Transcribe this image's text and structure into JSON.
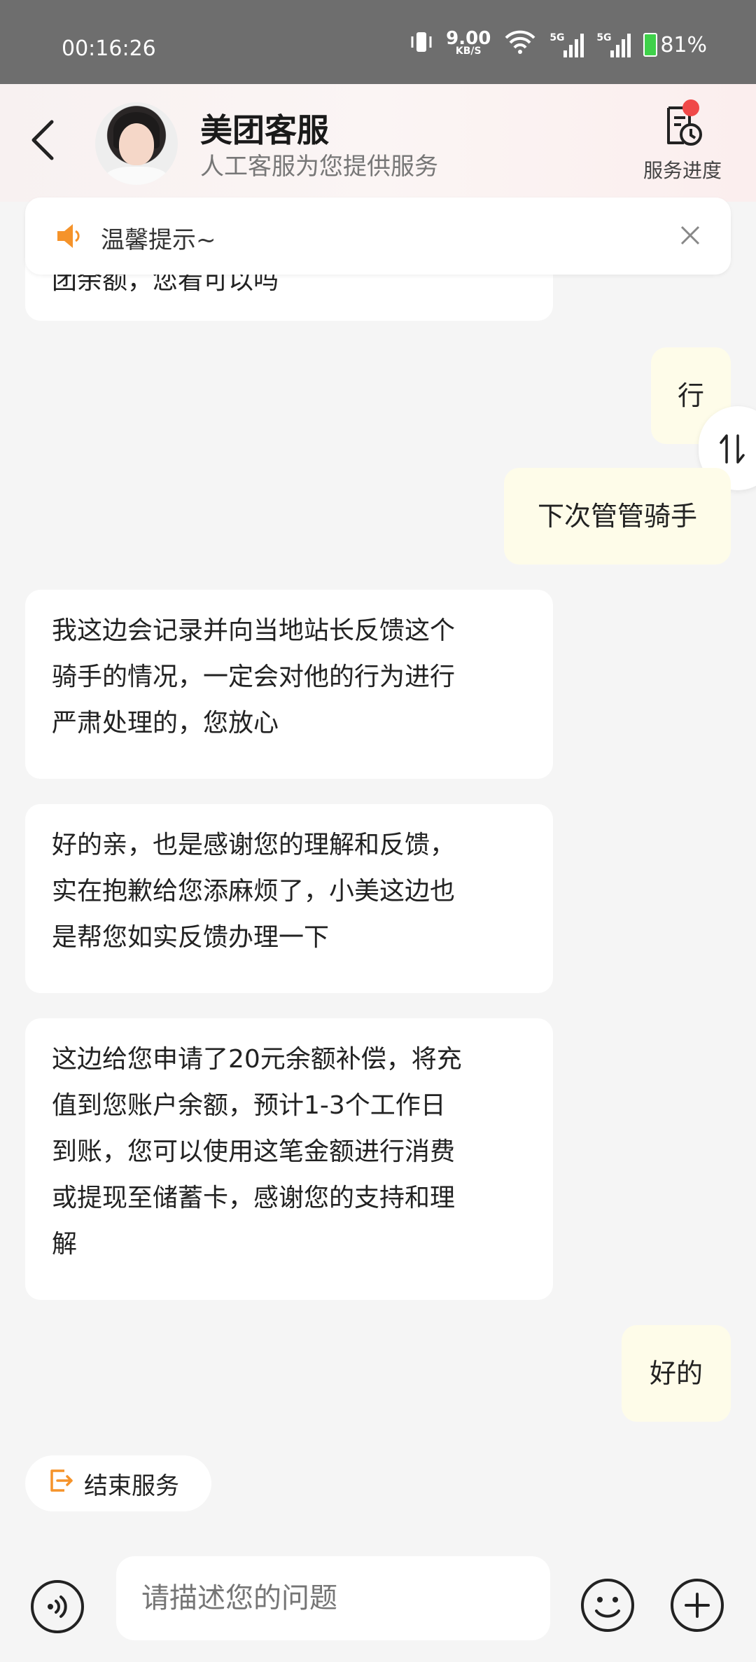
{
  "status_bar": {
    "time": "00:16:26",
    "net_speed": "9.00",
    "net_unit": "KB/S",
    "signal1_tag": "5G",
    "signal2_tag": "5G",
    "battery_percent": "81%"
  },
  "header": {
    "title": "美团客服",
    "subtitle": "人工客服为您提供服务",
    "service_progress_label": "服务进度"
  },
  "tip": {
    "text": "温馨提示~"
  },
  "messages": {
    "partial": "团余额，您看可以吗",
    "m1": "行",
    "m2": "下次管管骑手",
    "m3_l1": "我这边会记录并向当地站长反馈这个",
    "m3_l2": "骑手的情况，一定会对他的行为进行",
    "m3_l3": "严肃处理的，您放心",
    "m4_l1": "好的亲，也是感谢您的理解和反馈，",
    "m4_l2": "实在抱歉给您添麻烦了，小美这边也",
    "m4_l3": "是帮您如实反馈办理一下",
    "m5_l1": "这边给您申请了20元余额补偿，将充",
    "m5_l2": "值到您账户余额，预计1-3个工作日",
    "m5_l3": "到账，您可以使用这笔金额进行消费",
    "m5_l4": "或提现至储蓄卡，感谢您的支持和理",
    "m5_l5": "解",
    "m6": "好的"
  },
  "end_service": {
    "label": "结束服务"
  },
  "input": {
    "placeholder": "请描述您的问题"
  },
  "colors": {
    "accent": "#f5932a",
    "user_bubble": "#fefce9",
    "badge": "#f04848"
  }
}
